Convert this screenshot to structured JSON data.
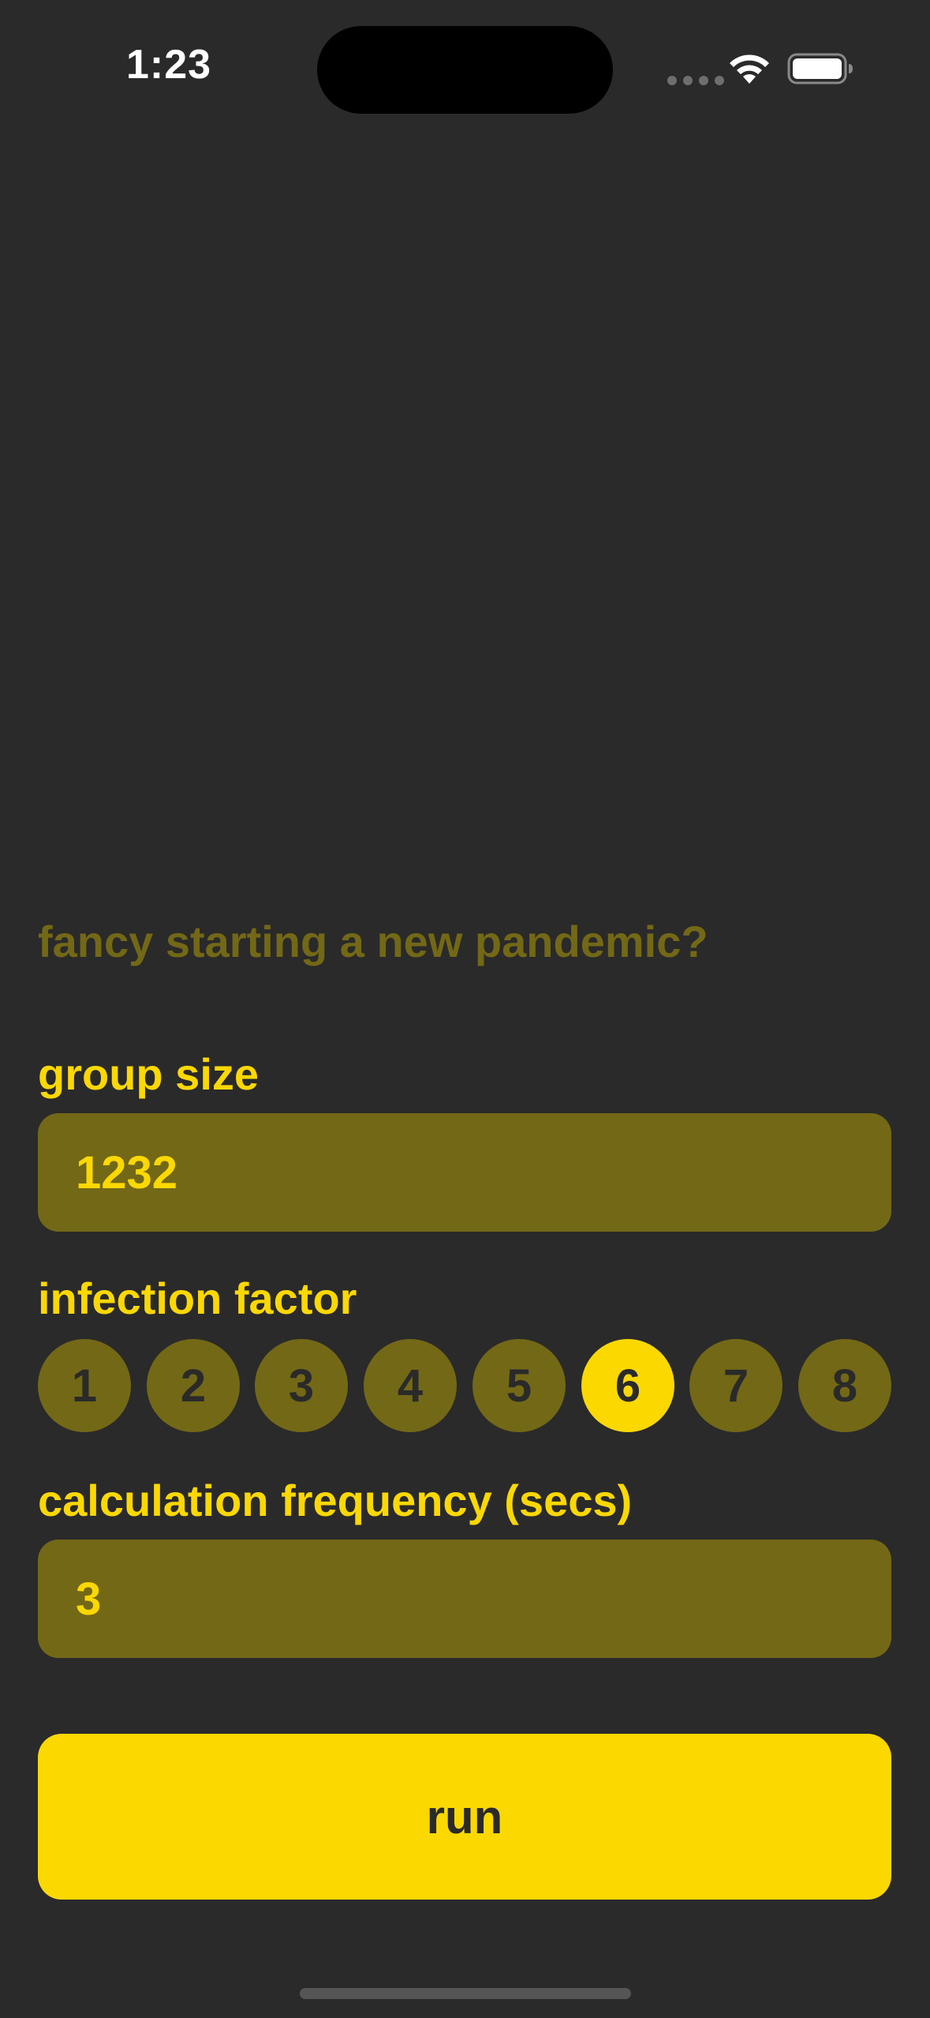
{
  "status_bar": {
    "time": "1:23",
    "wifi_icon": "wifi-icon",
    "battery_icon": "battery-icon"
  },
  "prompt": "fancy starting a new pandemic?",
  "group_size": {
    "label": "group size",
    "value": "1232"
  },
  "infection_factor": {
    "label": "infection factor",
    "options": [
      "1",
      "2",
      "3",
      "4",
      "5",
      "6",
      "7",
      "8"
    ],
    "selected": "6"
  },
  "calculation_frequency": {
    "label": "calculation frequency (secs)",
    "value": "3"
  },
  "run_label": "run",
  "colors": {
    "background": "#2a2a2a",
    "accent": "#fbd800",
    "muted_accent": "#736816"
  }
}
